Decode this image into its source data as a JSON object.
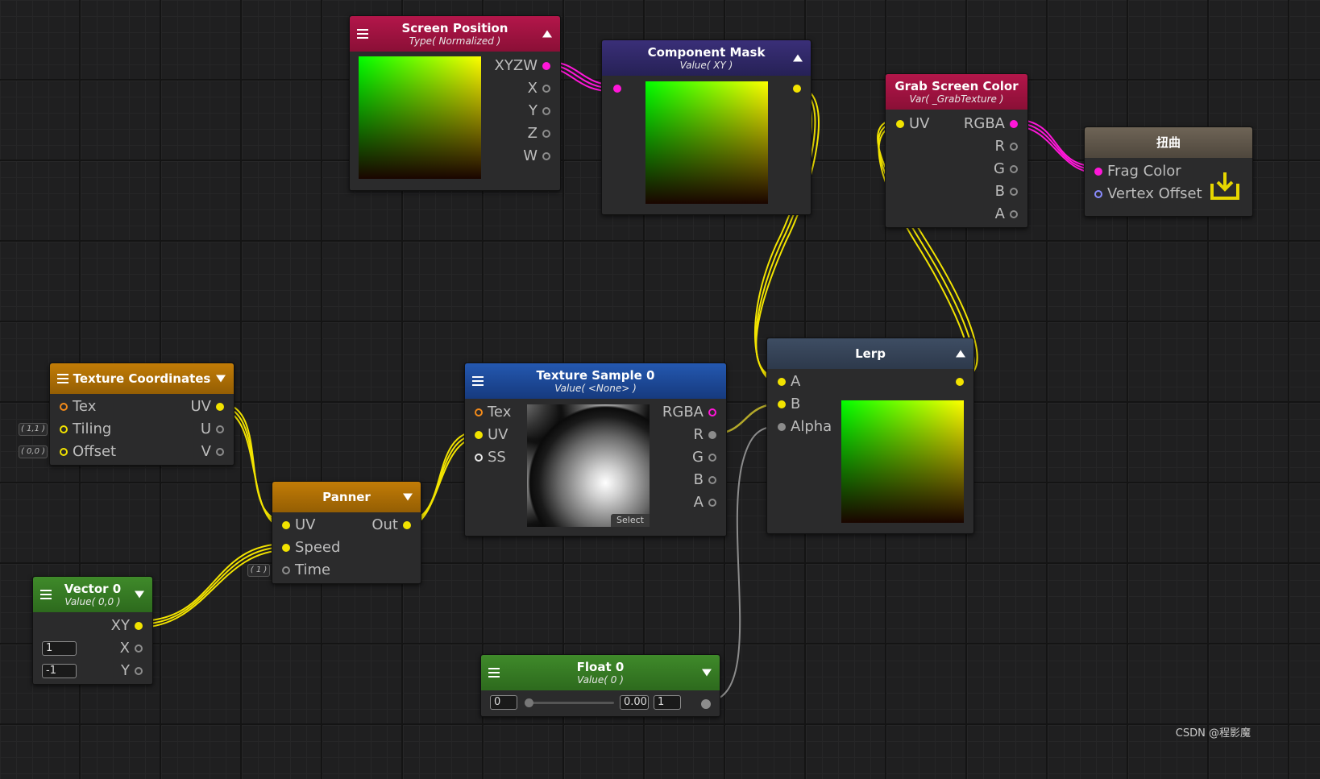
{
  "nodes": {
    "screen_position": {
      "title": "Screen Position",
      "subtitle": "Type( Normalized )",
      "outputs": [
        "XYZW",
        "X",
        "Y",
        "Z",
        "W"
      ]
    },
    "component_mask": {
      "title": "Component Mask",
      "subtitle": "Value( XY )"
    },
    "grab_screen_color": {
      "title": "Grab Screen Color",
      "subtitle": "Var( _GrabTexture )",
      "input": "UV",
      "outputs": [
        "RGBA",
        "R",
        "G",
        "B",
        "A"
      ]
    },
    "output": {
      "title": "扭曲",
      "inputs": [
        "Frag Color",
        "Vertex Offset"
      ]
    },
    "texture_coordinates": {
      "title": "Texture Coordinates",
      "inputs": [
        "Tex",
        "Tiling",
        "Offset"
      ],
      "outputs": [
        "UV",
        "U",
        "V"
      ],
      "tiling_default": "( 1,1 )",
      "offset_default": "( 0,0 )"
    },
    "panner": {
      "title": "Panner",
      "inputs": [
        "UV",
        "Speed",
        "Time"
      ],
      "output": "Out",
      "time_default": "( 1 )"
    },
    "texture_sample": {
      "title": "Texture Sample 0",
      "subtitle": "Value( <None> )",
      "inputs": [
        "Tex",
        "UV",
        "SS"
      ],
      "outputs": [
        "RGBA",
        "R",
        "G",
        "B",
        "A"
      ],
      "select_label": "Select"
    },
    "lerp": {
      "title": "Lerp",
      "inputs": [
        "A",
        "B",
        "Alpha"
      ]
    },
    "vector0": {
      "title": "Vector 0",
      "subtitle": "Value( 0,0 )",
      "output": "XY",
      "x_label": "X",
      "y_label": "Y",
      "x_value": "1",
      "y_value": "-1"
    },
    "float0": {
      "title": "Float 0",
      "subtitle": "Value( 0 )",
      "min": "0",
      "value": "0.00",
      "max": "1",
      "slider_fraction": 0.0
    }
  },
  "colors": {
    "wire_yellow": "#f2e300",
    "wire_magenta": "#ff17d9",
    "wire_gray": "#8c8c8c"
  },
  "watermark": "CSDN @程影魔"
}
